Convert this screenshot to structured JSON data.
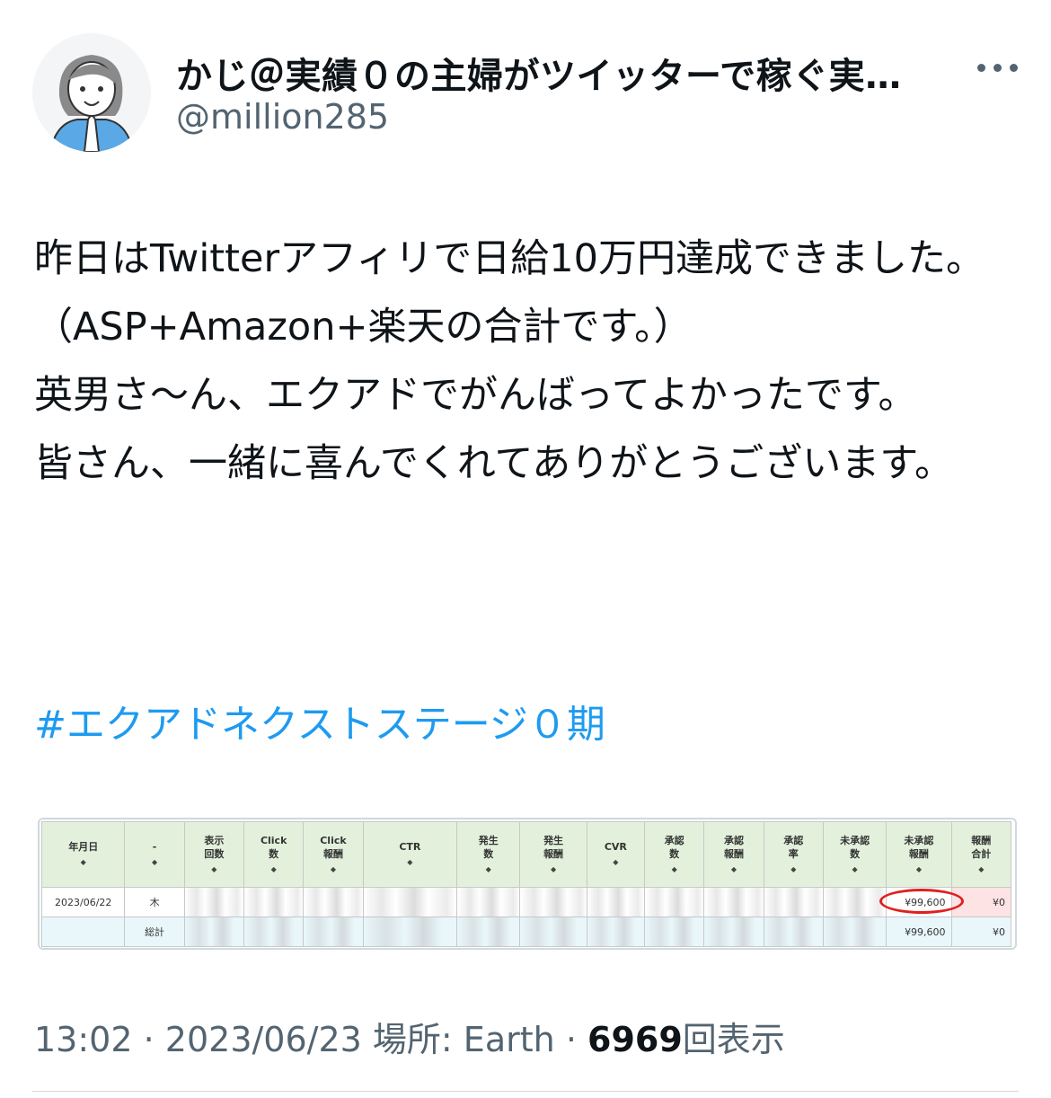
{
  "tweet": {
    "display_name": "かじ＠実績０の主婦がツイッターで稼ぐ実…",
    "handle": "@million285",
    "text": "昨日はTwitterアフィリで日給10万円達成できました。\n（ASP+Amazon+楽天の合計です。）\n英男さ〜ん、エクアドでがんばってよかったです。\n皆さん、一緒に喜んでくれてありがとうございます。",
    "hashtag": "#エクアドネクストステージ０期",
    "time": "13:02",
    "date": "2023/06/23",
    "location": "場所: Earth",
    "views": "6969",
    "views_label": "回表示",
    "sep": "·"
  },
  "report": {
    "headers": [
      "年月日",
      "-",
      "表示\n回数",
      "Click\n数",
      "Click\n報酬",
      "CTR",
      "発生\n数",
      "発生\n報酬",
      "CVR",
      "承認\n数",
      "承認\n報酬",
      "承認\n率",
      "未承認\n数",
      "未承認\n報酬",
      "報酬\n合計"
    ],
    "sort_glyph": "◆",
    "row1": {
      "date": "2023/06/22",
      "day": "木",
      "unapproved_reward": "¥99,600",
      "total": "¥0"
    },
    "row2": {
      "label": "総計",
      "unapproved_reward": "¥99,600",
      "total": "¥0"
    }
  },
  "colors": {
    "link": "#1d9bf0",
    "muted": "#536471",
    "highlight_circle": "#e02020"
  }
}
